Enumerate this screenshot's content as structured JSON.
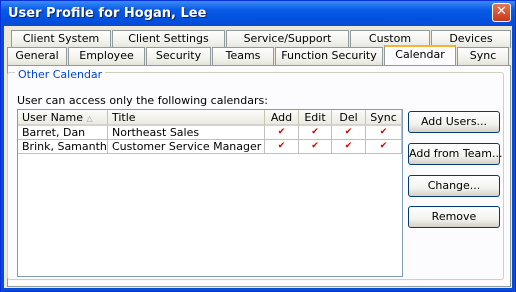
{
  "window": {
    "title": "User Profile for Hogan, Lee",
    "close_glyph": "✕"
  },
  "tabs_back": [
    "Client System",
    "Client Settings",
    "Service/Support",
    "Custom",
    "Devices"
  ],
  "tabs_front": [
    "General",
    "Employee",
    "Security",
    "Teams",
    "Function Security",
    "Calendar",
    "Sync"
  ],
  "active_tab": "Calendar",
  "group": {
    "title": "Other Calendar",
    "description": "User can access only the following calendars:"
  },
  "table": {
    "columns": [
      "User Name",
      "Title",
      "Add",
      "Edit",
      "Del",
      "Sync"
    ],
    "sort_glyph": "△",
    "check_glyph": "✔",
    "rows": [
      {
        "user_name": "Barret, Dan",
        "title": "Northeast Sales",
        "add": true,
        "edit": true,
        "del": true,
        "sync": true
      },
      {
        "user_name": "Brink, Samantha",
        "title": "Customer Service Manager",
        "add": true,
        "edit": true,
        "del": true,
        "sync": true
      }
    ]
  },
  "buttons": {
    "add_users": "Add Users...",
    "add_from_team": "Add from Team...",
    "change": "Change...",
    "remove": "Remove"
  }
}
